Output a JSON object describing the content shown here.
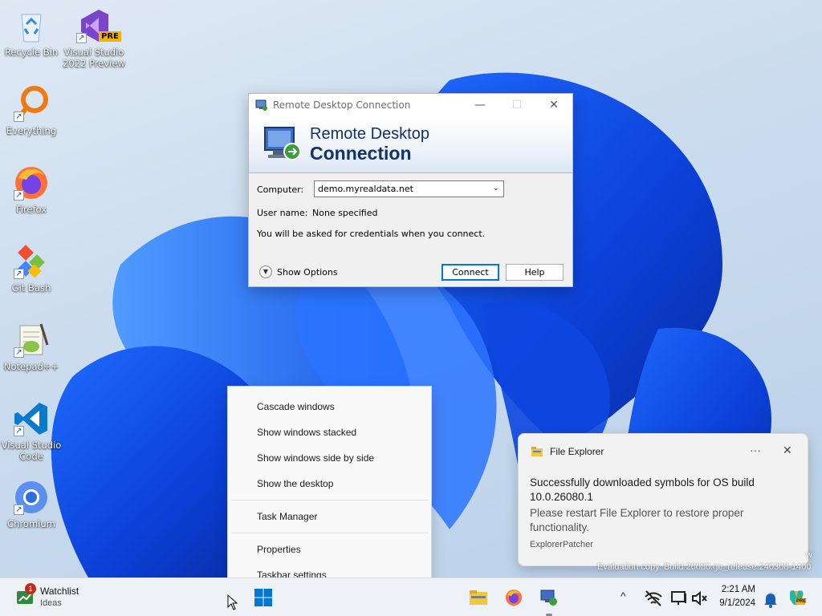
{
  "desktop": {
    "icons": [
      {
        "label_line1": "Recycle Bin",
        "label_line2": "",
        "icon": "recycle-bin-icon"
      },
      {
        "label_line1": "Visual Studio",
        "label_line2": "2022 Preview",
        "icon": "visual-studio-preview-icon",
        "badge": "PRE"
      },
      {
        "label_line1": "Everything",
        "label_line2": "",
        "icon": "everything-search-icon"
      },
      {
        "label_line1": "Firefox",
        "label_line2": "",
        "icon": "firefox-icon"
      },
      {
        "label_line1": "Git Bash",
        "label_line2": "",
        "icon": "git-bash-icon"
      },
      {
        "label_line1": "Notepad++",
        "label_line2": "",
        "icon": "notepad-plus-plus-icon"
      },
      {
        "label_line1": "Visual Studio",
        "label_line2": "Code",
        "icon": "vscode-icon"
      },
      {
        "label_line1": "Chromium",
        "label_line2": "",
        "icon": "chromium-icon"
      }
    ],
    "shortcut_glyph": "↗"
  },
  "rdc": {
    "title": "Remote Desktop Connection",
    "banner_line1": "Remote Desktop",
    "banner_line2": "Connection",
    "computer_label": "Computer:",
    "computer_value": "demo.myrealdata.net",
    "username_label": "User name:",
    "username_value": "None specified",
    "info_text": "You will be asked for credentials when you connect.",
    "show_options": "Show Options",
    "connect": "Connect",
    "help": "Help",
    "minimize_glyph": "—",
    "maximize_glyph": "☐",
    "close_glyph": "✕"
  },
  "context_menu": {
    "items_group1": [
      "Cascade windows",
      "Show windows stacked",
      "Show windows side by side",
      "Show the desktop"
    ],
    "items_group2": [
      "Task Manager"
    ],
    "items_group3": [
      "Properties",
      "Taskbar settings"
    ]
  },
  "toast": {
    "app_name": "File Explorer",
    "more_glyph": "···",
    "close_glyph": "✕",
    "headline_line1": "Successfully downloaded symbols for OS build",
    "headline_line2": "10.0.26080.1",
    "body_line1": "Please restart File Explorer to restore proper",
    "body_line2": "functionality.",
    "attribution": "ExplorerPatcher"
  },
  "watermark": {
    "line": "Evaluation copy. Build 26080.ge_release.240308-1400",
    "edge": "w"
  },
  "taskbar": {
    "widget_title": "Watchlist",
    "widget_subtitle": "Ideas",
    "widget_badge": "1",
    "clock_time": "2:21 AM",
    "clock_date": "9/1/2024",
    "tray_chevron": "^",
    "colors": {
      "accent": "#0078d4",
      "badge": "#c42b1c",
      "bar": "#eef1f5"
    }
  }
}
